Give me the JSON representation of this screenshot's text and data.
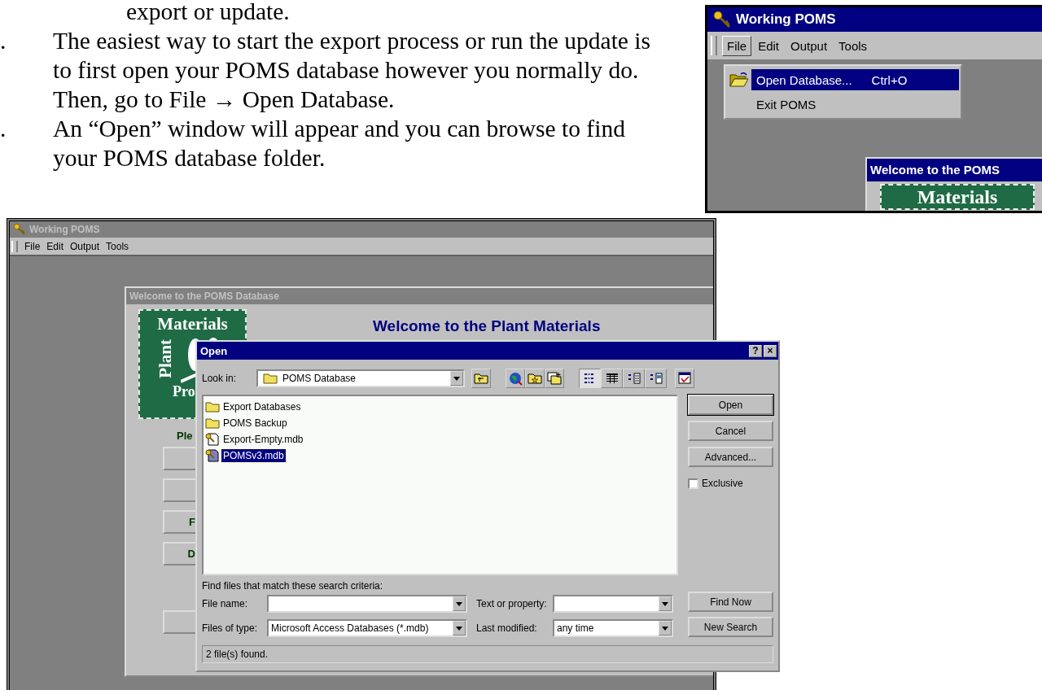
{
  "document": {
    "continuation": "export or update.",
    "items": [
      {
        "marker": ".",
        "text": "The easiest way to start the export process or run the update is to first open your POMS database however you normally do. Then, go to File → Open Database."
      },
      {
        "marker": ".",
        "text": "An “Open” window will appear and you can browse to find your POMS database folder."
      }
    ]
  },
  "inset": {
    "title": "Working POMS",
    "active": true,
    "menu": [
      {
        "label": "File",
        "selected": true
      },
      {
        "label": "Edit",
        "selected": false
      },
      {
        "label": "Output",
        "selected": false
      },
      {
        "label": "Tools",
        "selected": false
      }
    ],
    "dropdown": [
      {
        "kind": "icon",
        "label": "Open Database...",
        "shortcut": "Ctrl+O",
        "selected": true
      },
      {
        "kind": "plain",
        "label": "Exit POMS",
        "selected": false
      }
    ],
    "child_title": "Welcome to the POMS",
    "child_active": true,
    "child_logo": "Materials"
  },
  "main": {
    "title": "Working POMS",
    "active": false,
    "menu": [
      "File",
      "Edit",
      "Output",
      "Tools"
    ],
    "welcome": {
      "title": "Welcome to the POMS Database",
      "active": false,
      "logo": {
        "top": "Materials",
        "side": "Plant",
        "bottom": "Pro"
      },
      "heading": "Welcome to the Plant Materials",
      "prompt": "Ple",
      "buttons": [
        {
          "kind": "blank"
        },
        {
          "kind": "blank"
        },
        {
          "kind": "labelled",
          "label": "F"
        },
        {
          "kind": "labelled",
          "label": "D"
        },
        {
          "kind": "blank"
        }
      ]
    }
  },
  "dialog": {
    "title": "Open",
    "active": true,
    "title_buttons": [
      "?",
      "×"
    ],
    "look_in": {
      "label": "Look in:",
      "value": "POMS Database"
    },
    "view_buttons": [
      {
        "selected": true
      },
      {
        "selected": false
      },
      {
        "selected": false
      },
      {
        "selected": false
      }
    ],
    "files": [
      {
        "kind": "folder",
        "name": "Export Databases",
        "selected": false
      },
      {
        "kind": "folder",
        "name": "POMS Backup",
        "selected": false
      },
      {
        "kind": "database",
        "name": "Export-Empty.mdb",
        "selected": false
      },
      {
        "kind": "database",
        "name": "POMSv3.mdb",
        "selected": true
      }
    ],
    "buttons": [
      {
        "label": "Open",
        "default": true
      },
      {
        "label": "Cancel",
        "default": false
      },
      {
        "label": "Advanced...",
        "default": false
      }
    ],
    "exclusive": {
      "label": "Exclusive",
      "checked": false
    },
    "criteria_heading": "Find files that match these search criteria:",
    "fields": [
      {
        "label": "File name:"
      },
      {
        "label": "Text or property:"
      },
      {
        "label": "Files of type:",
        "value": "Microsoft Access Databases (*.mdb)"
      },
      {
        "label": "Last modified:",
        "value": "any time"
      }
    ],
    "search_buttons": [
      "Find Now",
      "New Search"
    ],
    "status": "2 file(s) found."
  }
}
